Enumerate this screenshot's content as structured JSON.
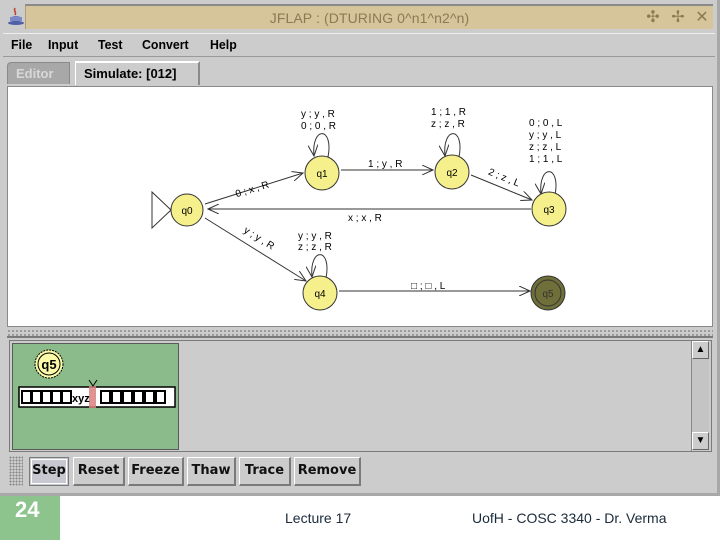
{
  "window": {
    "title": "JFLAP : (DTURING 0^n1^n2^n)",
    "title_buttons": [
      "minimize-icon",
      "maximize-icon",
      "close-icon"
    ]
  },
  "menu": {
    "items": [
      {
        "label": "File"
      },
      {
        "label": "Input"
      },
      {
        "label": "Test"
      },
      {
        "label": "Convert"
      },
      {
        "label": "Help"
      }
    ]
  },
  "tabs": [
    {
      "label": "Editor",
      "active": false
    },
    {
      "label": "Simulate: [012]",
      "active": true
    }
  ],
  "automaton": {
    "colors": {
      "state_fill": "#f5f08c",
      "final_fill": "#6f6f3a",
      "edge": "#333333"
    },
    "states": [
      {
        "id": "q0",
        "label": "q0",
        "initial": true,
        "final": false
      },
      {
        "id": "q1",
        "label": "q1",
        "initial": false,
        "final": false
      },
      {
        "id": "q2",
        "label": "q2",
        "initial": false,
        "final": false
      },
      {
        "id": "q3",
        "label": "q3",
        "initial": false,
        "final": false
      },
      {
        "id": "q4",
        "label": "q4",
        "initial": false,
        "final": false
      },
      {
        "id": "q5",
        "label": "q5",
        "initial": false,
        "final": true
      }
    ],
    "transitions": [
      {
        "from": "q0",
        "to": "q1",
        "labels": [
          "0 ; x , R"
        ]
      },
      {
        "from": "q1",
        "to": "q1",
        "labels": [
          "y ; y , R",
          "0 ; 0 , R"
        ]
      },
      {
        "from": "q1",
        "to": "q2",
        "labels": [
          "1 ; y , R"
        ]
      },
      {
        "from": "q2",
        "to": "q2",
        "labels": [
          "1 ; 1 , R",
          "z ; z , R"
        ]
      },
      {
        "from": "q2",
        "to": "q3",
        "labels": [
          "2 ; z , L"
        ]
      },
      {
        "from": "q3",
        "to": "q3",
        "labels": [
          "0 ; 0 , L",
          "y ; y , L",
          "z ; z , L",
          "1 ; 1 , L"
        ]
      },
      {
        "from": "q3",
        "to": "q0",
        "labels": [
          "x ; x , R"
        ]
      },
      {
        "from": "q0",
        "to": "q4",
        "labels": [
          "y ; y , R"
        ]
      },
      {
        "from": "q4",
        "to": "q4",
        "labels": [
          "y ; y , R",
          "z ; z , R"
        ]
      },
      {
        "from": "q4",
        "to": "q5",
        "labels": [
          "□ ; □ , L"
        ]
      }
    ]
  },
  "simulation": {
    "configurations": [
      {
        "state": "q5",
        "status": "accepted",
        "tape": {
          "left_blanks": 5,
          "contents": "xyz",
          "head_on": "z",
          "right_blanks": 6
        },
        "background": "#8bbb8b",
        "head_color": "#d98080"
      }
    ],
    "buttons": [
      {
        "label": "Step"
      },
      {
        "label": "Reset"
      },
      {
        "label": "Freeze"
      },
      {
        "label": "Thaw"
      },
      {
        "label": "Trace"
      },
      {
        "label": "Remove"
      }
    ]
  },
  "slide_footer": {
    "page_number": "24",
    "center": "Lecture 17",
    "right": "UofH - COSC 3340 - Dr. Verma"
  }
}
